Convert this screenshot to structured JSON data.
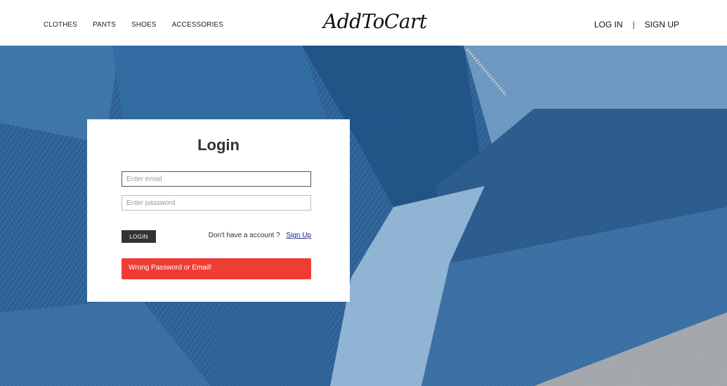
{
  "nav": {
    "links": [
      "CLOTHES",
      "PANTS",
      "SHOES",
      "ACCESSORIES"
    ],
    "brand": "AddToCart",
    "login": "LOG IN",
    "separator": "|",
    "signup": "SIGN UP"
  },
  "login_form": {
    "title": "Login",
    "email_placeholder": "Enter email",
    "password_placeholder": "Enter password",
    "button_label": "LOGIN",
    "no_account_text": "Don't have a account ?",
    "signup_link": "Sign Up",
    "error_message": "Wrong Password or Email!"
  },
  "colors": {
    "error": "#f03d33",
    "button": "#333333",
    "link": "#1a237e",
    "denim_dark": "#1f5285",
    "denim_light": "#7fa9cc"
  }
}
